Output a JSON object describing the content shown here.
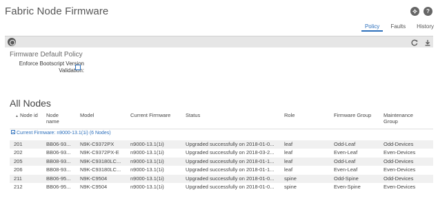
{
  "header": {
    "title": "Fabric Node Firmware",
    "help_icon_glyph": "?"
  },
  "tabs": [
    {
      "label": "Policy",
      "active": true
    },
    {
      "label": "Faults",
      "active": false
    },
    {
      "label": "History",
      "active": false
    }
  ],
  "toolbar": {
    "left_icon": "policy-icon",
    "refresh_icon": "refresh-icon",
    "download_icon": "download-icon"
  },
  "policy": {
    "section_title": "Firmware Default Policy",
    "enforce_label": "Enforce Bootscript Version Validation:",
    "enforce_checked": false
  },
  "nodes": {
    "title": "All Nodes",
    "columns": {
      "node_id": "Node id",
      "node_name": "Node name",
      "model": "Model",
      "current_firmware": "Current Firmware",
      "status": "Status",
      "role": "Role",
      "firmware_group": "Firmware Group",
      "maintenance_group": "Maintenance Group"
    },
    "group_label": "Current Firmware: n9000-13.1(1i) (6 Nodes)",
    "rows": [
      {
        "node_id": "201",
        "node_name": "BB06-93...",
        "model": "N9K-C9372PX",
        "current_firmware": "n9000-13.1(1i)",
        "status": "Upgraded successfully on 2018-01-0...",
        "role": "leaf",
        "firmware_group": "Odd-Leaf",
        "maintenance_group": "Odd-Devices"
      },
      {
        "node_id": "202",
        "node_name": "BB06-93...",
        "model": "N9K-C9372PX-E",
        "current_firmware": "n9000-13.1(1i)",
        "status": "Upgraded successfully on 2018-03-2...",
        "role": "leaf",
        "firmware_group": "Even-Leaf",
        "maintenance_group": "Even-Devices"
      },
      {
        "node_id": "205",
        "node_name": "BB08-93...",
        "model": "N9K-C93180LC...",
        "current_firmware": "n9000-13.1(1i)",
        "status": "Upgraded successfully on 2018-01-1...",
        "role": "leaf",
        "firmware_group": "Odd-Leaf",
        "maintenance_group": "Odd-Devices"
      },
      {
        "node_id": "206",
        "node_name": "BB08-93...",
        "model": "N9K-C93180LC...",
        "current_firmware": "n9000-13.1(1i)",
        "status": "Upgraded successfully on 2018-01-1...",
        "role": "leaf",
        "firmware_group": "Even-Leaf",
        "maintenance_group": "Even-Devices"
      },
      {
        "node_id": "211",
        "node_name": "BB06-95...",
        "model": "N9K-C9504",
        "current_firmware": "n9000-13.1(1i)",
        "status": "Upgraded successfully on 2018-01-0...",
        "role": "spine",
        "firmware_group": "Odd-Spine",
        "maintenance_group": "Odd-Devices"
      },
      {
        "node_id": "212",
        "node_name": "BB06-95...",
        "model": "N9K-C9504",
        "current_firmware": "n9000-13.1(1i)",
        "status": "Upgraded successfully on 2018-01-0...",
        "role": "spine",
        "firmware_group": "Even-Spine",
        "maintenance_group": "Even-Devices"
      }
    ]
  },
  "colors": {
    "accent": "#2a6ebb",
    "toolbar_bg": "#e6e6e6",
    "row_alt_bg": "#f0f0f0"
  }
}
